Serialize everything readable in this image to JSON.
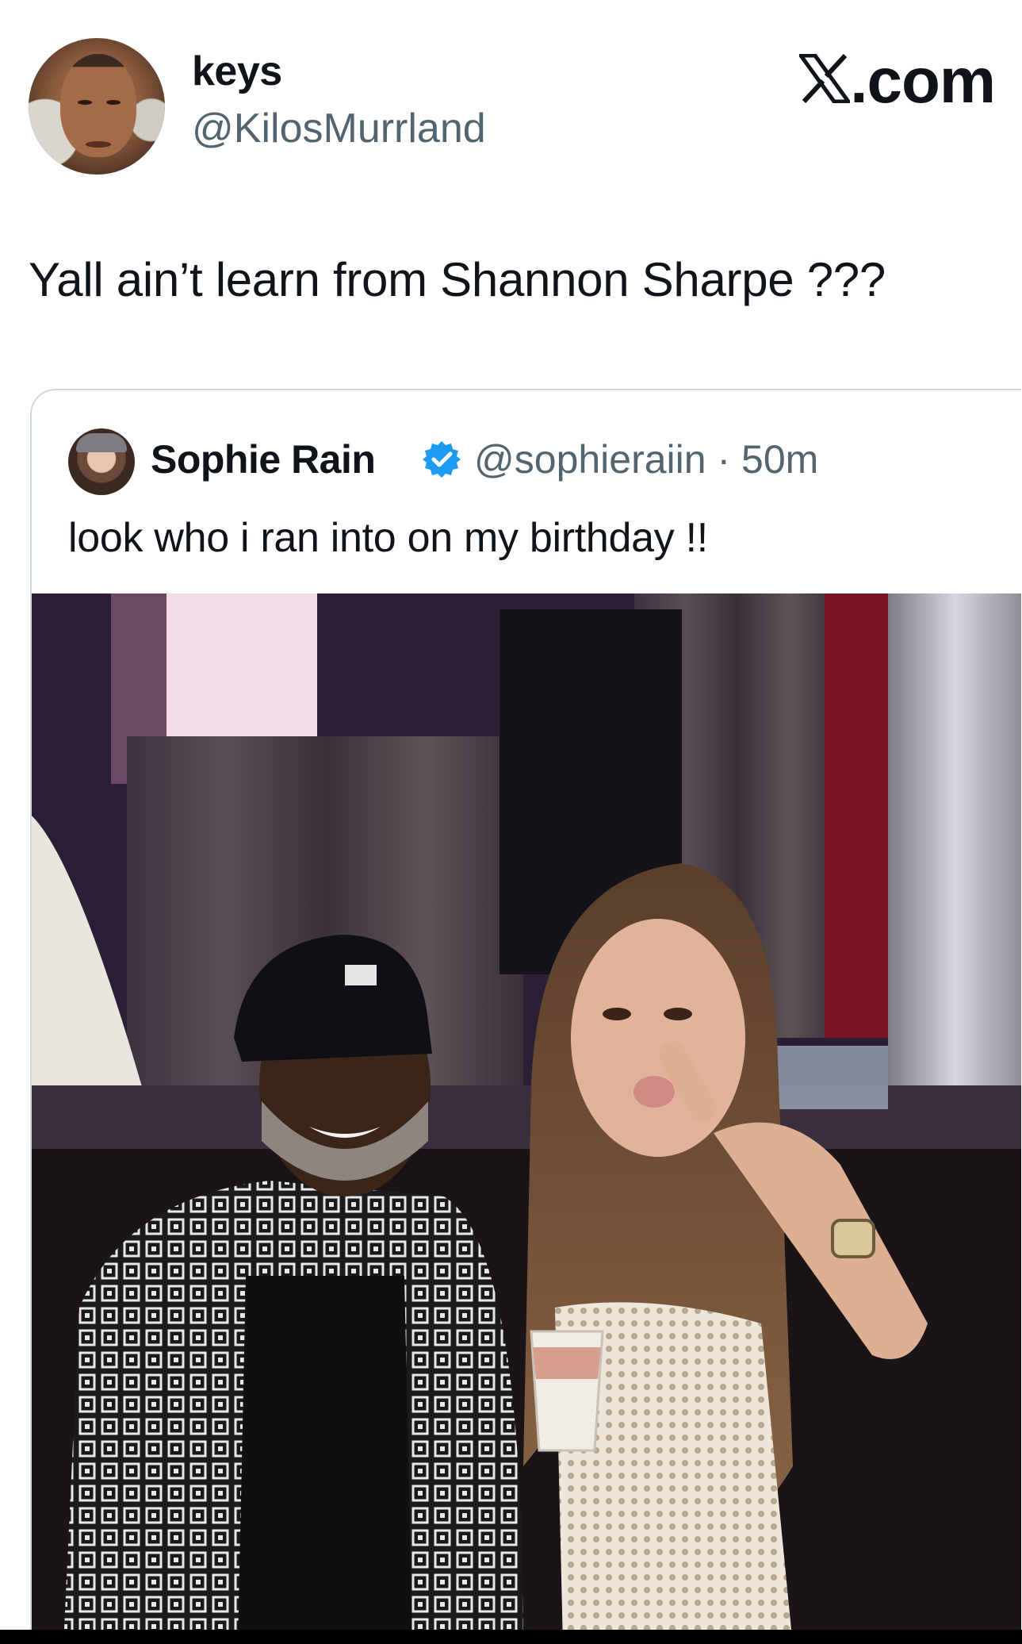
{
  "post": {
    "display_name": "keys",
    "handle": "@KilosMurrland",
    "brand_label": ".com",
    "text": "Yall ain’t learn from Shannon Sharpe ???"
  },
  "quoted_post": {
    "display_name": "Sophie Rain",
    "verified": true,
    "handle_time": "@sophieraiin · 50m",
    "text": "look who i ran into on my birthday !!"
  },
  "colors": {
    "text_primary": "#0f1419",
    "text_secondary": "#536471",
    "border": "#cfd9de",
    "verified_blue": "#1d9bf0"
  }
}
